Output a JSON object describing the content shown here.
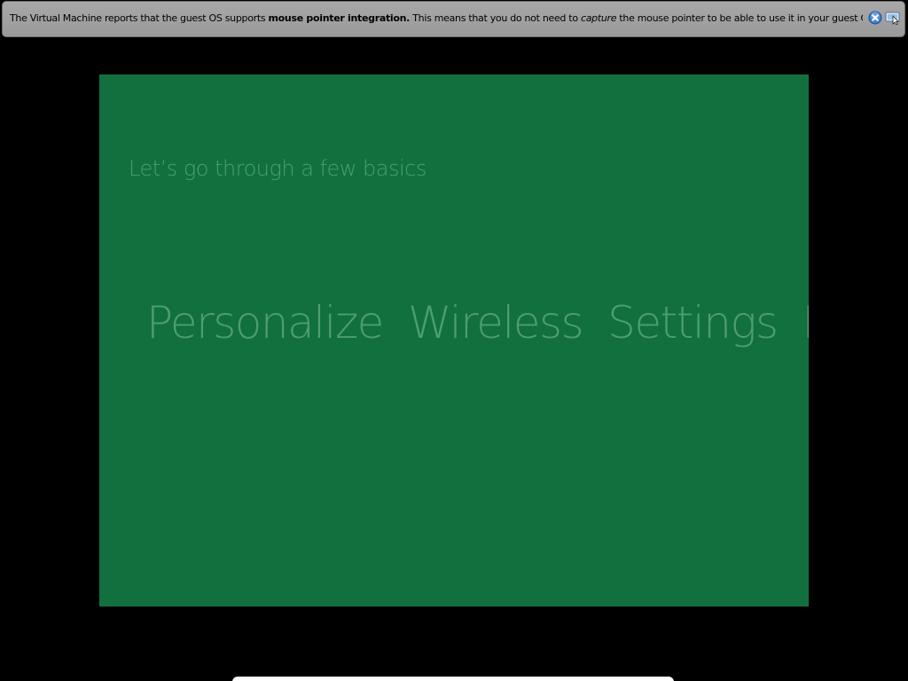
{
  "notification": {
    "text_part1": "The Virtual Machine reports that the guest OS supports ",
    "text_bold": "mouse pointer integration.",
    "text_part2": " This means that you do not need to ",
    "text_italic": "capture",
    "text_part3": " the mouse pointer to be able to use it in your guest OS -- all mouse",
    "close_icon": "close-icon",
    "dont_show_icon": "mouse-integration-icon"
  },
  "guest": {
    "background_color": "#11703e",
    "text_color": "#4e9d70",
    "subtitle": "Let’s go through a few basics",
    "steps": [
      {
        "label": "Personalize"
      },
      {
        "label": "Wireless"
      },
      {
        "label": "Settings"
      },
      {
        "label": "L"
      }
    ]
  }
}
